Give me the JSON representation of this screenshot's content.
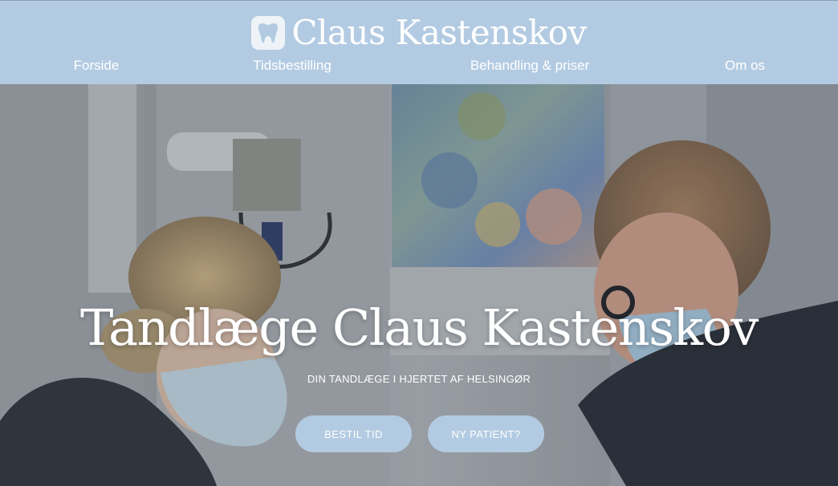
{
  "header": {
    "logo_icon": "tooth-icon",
    "brand": "Claus Kastenskov",
    "background": "#b3cbe2"
  },
  "nav": {
    "items": [
      {
        "label": "Forside"
      },
      {
        "label": "Tidsbestilling"
      },
      {
        "label": "Behandling & priser"
      },
      {
        "label": "Om os"
      }
    ]
  },
  "hero": {
    "image_description_icon": "dentist-photo",
    "title": "Tandlæge Claus Kastenskov",
    "subtitle": "DIN TANDLÆGE I HJERTET AF HELSINGØR",
    "buttons": [
      {
        "label": "BESTIL TID"
      },
      {
        "label": "NY PATIENT?"
      }
    ]
  }
}
